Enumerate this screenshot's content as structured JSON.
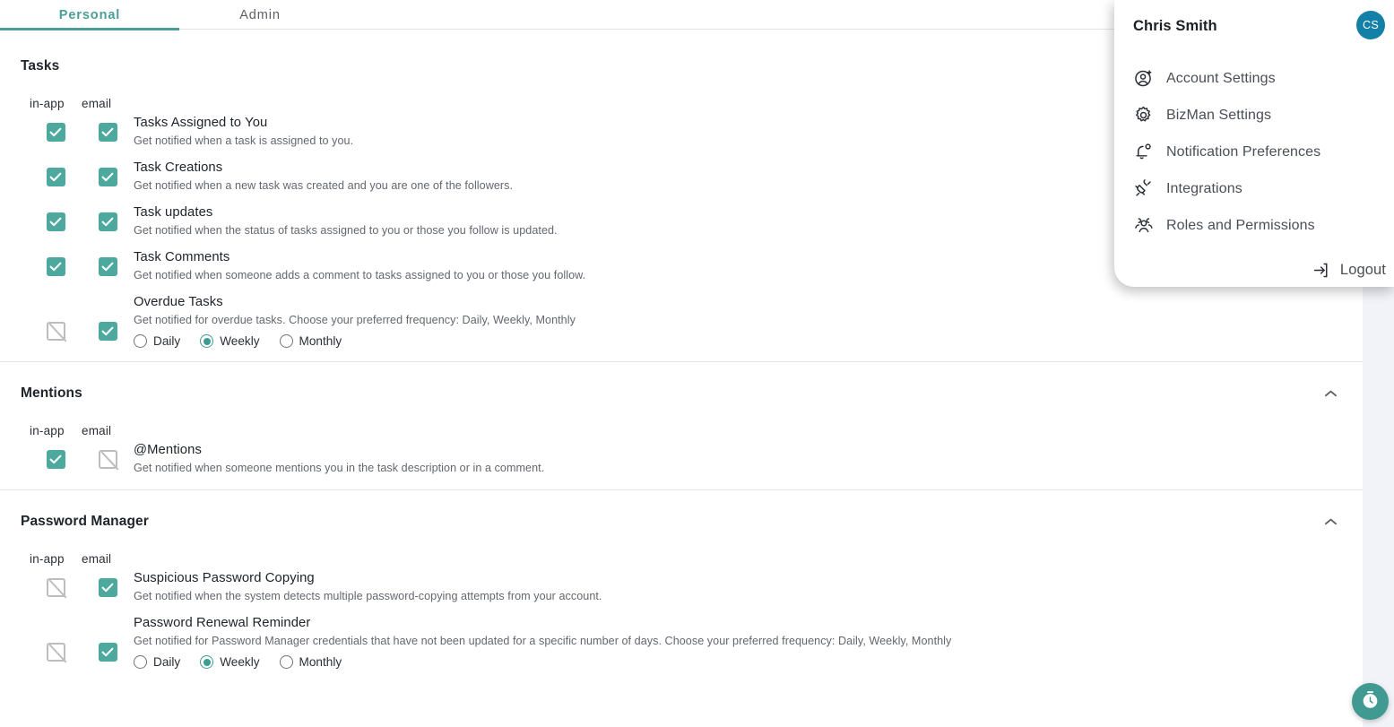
{
  "tabs": [
    {
      "label": "Personal",
      "active": true
    },
    {
      "label": "Admin",
      "active": false
    }
  ],
  "columns": {
    "in_app": "in-app",
    "email": "email"
  },
  "colors": {
    "accent_teal": "#4b9e97",
    "checkbox_teal": "#4da89e",
    "radio_teal": "#3f9c93",
    "avatar_blue": "#1380a8",
    "fab_teal": "#419a92",
    "disabled_gray": "#bdbdbd",
    "gutter": "#f1f3f8"
  },
  "sections": [
    {
      "title": "Tasks",
      "collapsible": false,
      "rows": [
        {
          "title": "Tasks Assigned to You",
          "desc": "Get notified when a task is assigned to you.",
          "in_app": "checked",
          "email": "checked"
        },
        {
          "title": "Task Creations",
          "desc": "Get notified when a new task was created and you are one of the followers.",
          "in_app": "checked",
          "email": "checked"
        },
        {
          "title": "Task updates",
          "desc": "Get notified when the status of tasks assigned to you or those you follow is updated.",
          "in_app": "checked",
          "email": "checked"
        },
        {
          "title": "Task Comments",
          "desc": "Get notified when someone adds a comment to tasks assigned to you or those you follow.",
          "in_app": "checked",
          "email": "checked"
        },
        {
          "title": "Overdue Tasks",
          "desc": "Get notified for overdue tasks. Choose your preferred frequency: Daily, Weekly, Monthly",
          "in_app": "disabled",
          "email": "checked",
          "frequency": {
            "options": [
              "Daily",
              "Weekly",
              "Monthly"
            ],
            "selected": "Weekly"
          }
        }
      ]
    },
    {
      "title": "Mentions",
      "collapsible": true,
      "rows": [
        {
          "title": "@Mentions",
          "desc": "Get notified when someone mentions you in the task description or in a comment.",
          "in_app": "checked",
          "email": "disabled"
        }
      ]
    },
    {
      "title": "Password Manager",
      "collapsible": true,
      "rows": [
        {
          "title": "Suspicious Password Copying",
          "desc": "Get notified when the system detects multiple password-copying attempts from your account.",
          "in_app": "disabled",
          "email": "checked"
        },
        {
          "title": "Password Renewal Reminder",
          "desc": "Get notified for Password Manager credentials that have not been updated for a specific number of days. Choose your preferred frequency: Daily, Weekly, Monthly",
          "in_app": "disabled",
          "email": "checked",
          "frequency": {
            "options": [
              "Daily",
              "Weekly",
              "Monthly"
            ],
            "selected": "Weekly"
          }
        }
      ]
    }
  ],
  "account_menu": {
    "user_name": "Chris Smith",
    "avatar_initials": "CS",
    "items": [
      {
        "label": "Account Settings",
        "icon": "user-settings-icon"
      },
      {
        "label": "BizMan Settings",
        "icon": "gear-icon"
      },
      {
        "label": "Notification Preferences",
        "icon": "bell-icon"
      },
      {
        "label": "Integrations",
        "icon": "plug-icon"
      },
      {
        "label": "Roles and Permissions",
        "icon": "users-group-icon"
      }
    ],
    "logout": {
      "label": "Logout",
      "icon": "sign-out-icon"
    }
  },
  "fab": {
    "icon": "stopwatch-icon"
  }
}
